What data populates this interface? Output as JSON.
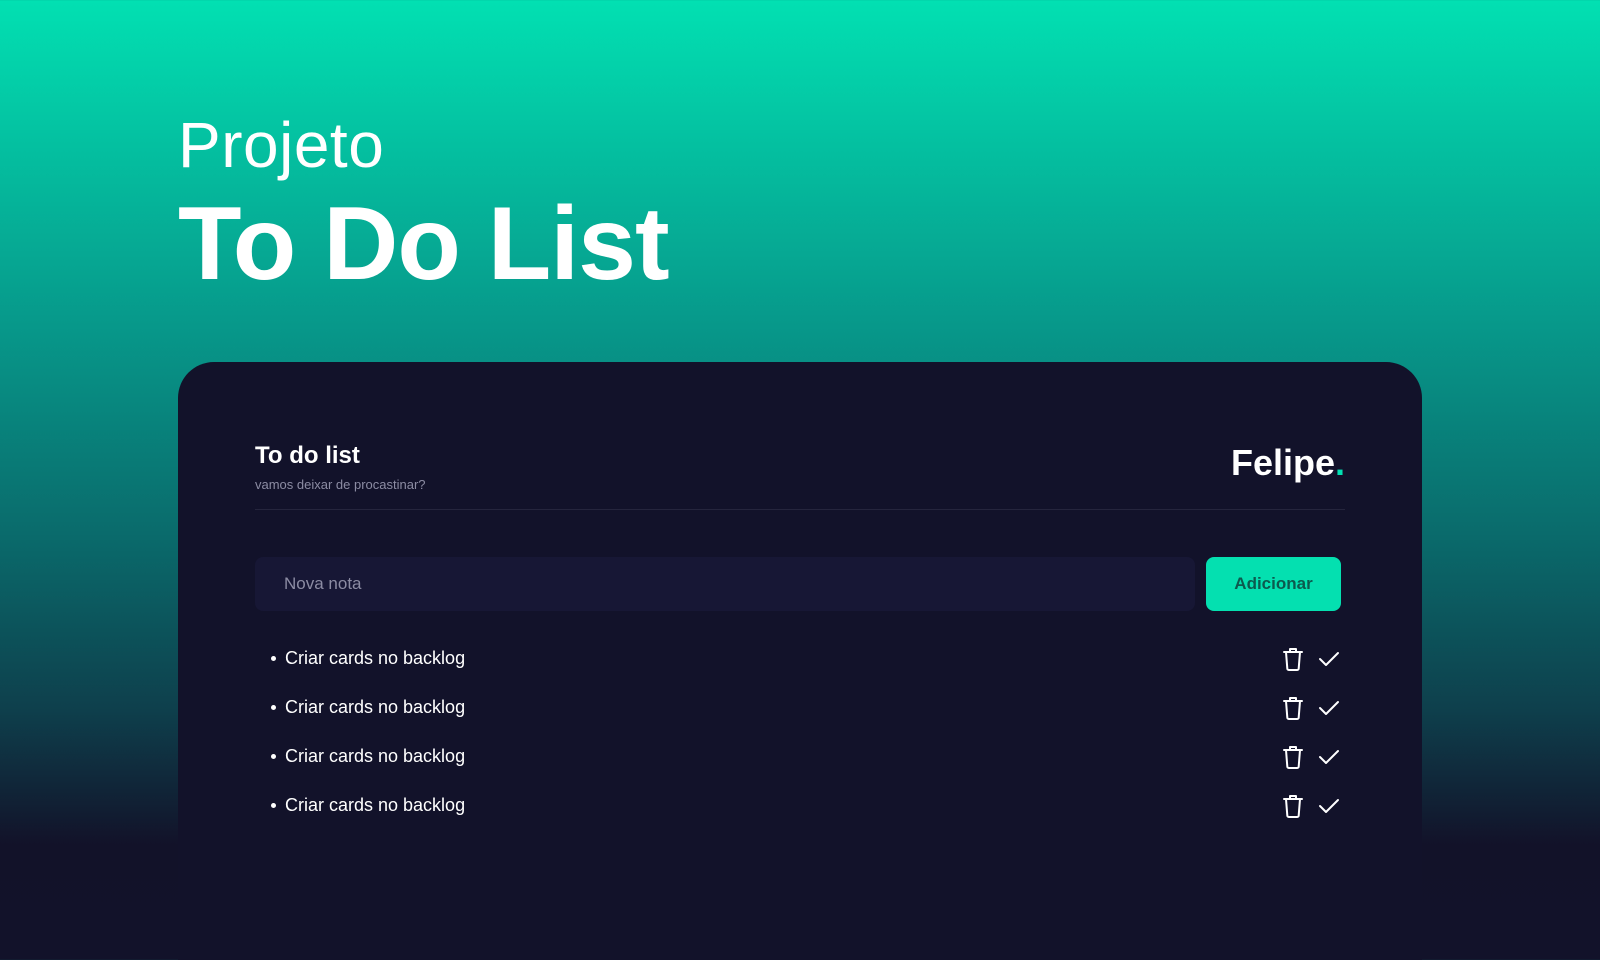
{
  "hero": {
    "subtitle": "Projeto",
    "title": "To Do List"
  },
  "app": {
    "title": "To do list",
    "subtitle": "vamos deixar de procastinar?",
    "brand_name": "Felipe",
    "brand_dot": "."
  },
  "form": {
    "placeholder": "Nova nota",
    "value": "",
    "add_label": "Adicionar"
  },
  "tasks": [
    {
      "text": "Criar cards no backlog"
    },
    {
      "text": "Criar cards no backlog"
    },
    {
      "text": "Criar cards no backlog"
    },
    {
      "text": "Criar cards no backlog"
    }
  ],
  "icons": {
    "delete": "trash-icon",
    "complete": "check-icon"
  },
  "colors": {
    "accent": "#02e0b2",
    "card_background": "#12122a",
    "input_background": "#171735",
    "button_text": "#0c5a4e",
    "muted_text": "#8c8ca3"
  }
}
